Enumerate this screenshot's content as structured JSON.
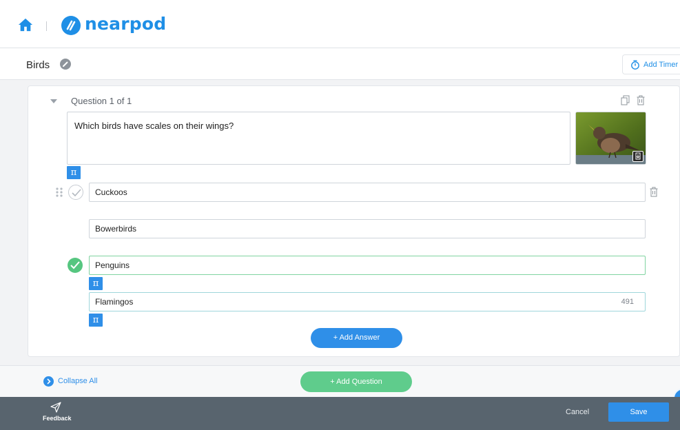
{
  "header": {
    "brand": "nearpod",
    "icons": [
      "home-icon",
      "nearpod-logo-icon"
    ]
  },
  "titlebar": {
    "lesson_title": "Birds",
    "add_timer_label": "Add Timer"
  },
  "question": {
    "heading": "Question 1 of 1",
    "text": "Which birds have scales on their wings?",
    "pi_symbol": "π"
  },
  "answers": [
    {
      "text": "Cuckoos",
      "correct": false
    },
    {
      "text": "Bowerbirds",
      "correct": false
    },
    {
      "text": "Penguins",
      "correct": true
    },
    {
      "text": "Flamingos",
      "correct": false,
      "char_count": "491"
    }
  ],
  "actions": {
    "add_answer": "+ Add Answer",
    "add_question": "+ Add Question",
    "collapse_all": "Collapse All"
  },
  "footer": {
    "feedback": "Feedback",
    "cancel": "Cancel",
    "save": "Save"
  },
  "colors": {
    "brand_blue": "#2f8fe8",
    "correct_green": "#56c680",
    "footer_gray": "#58646e"
  }
}
